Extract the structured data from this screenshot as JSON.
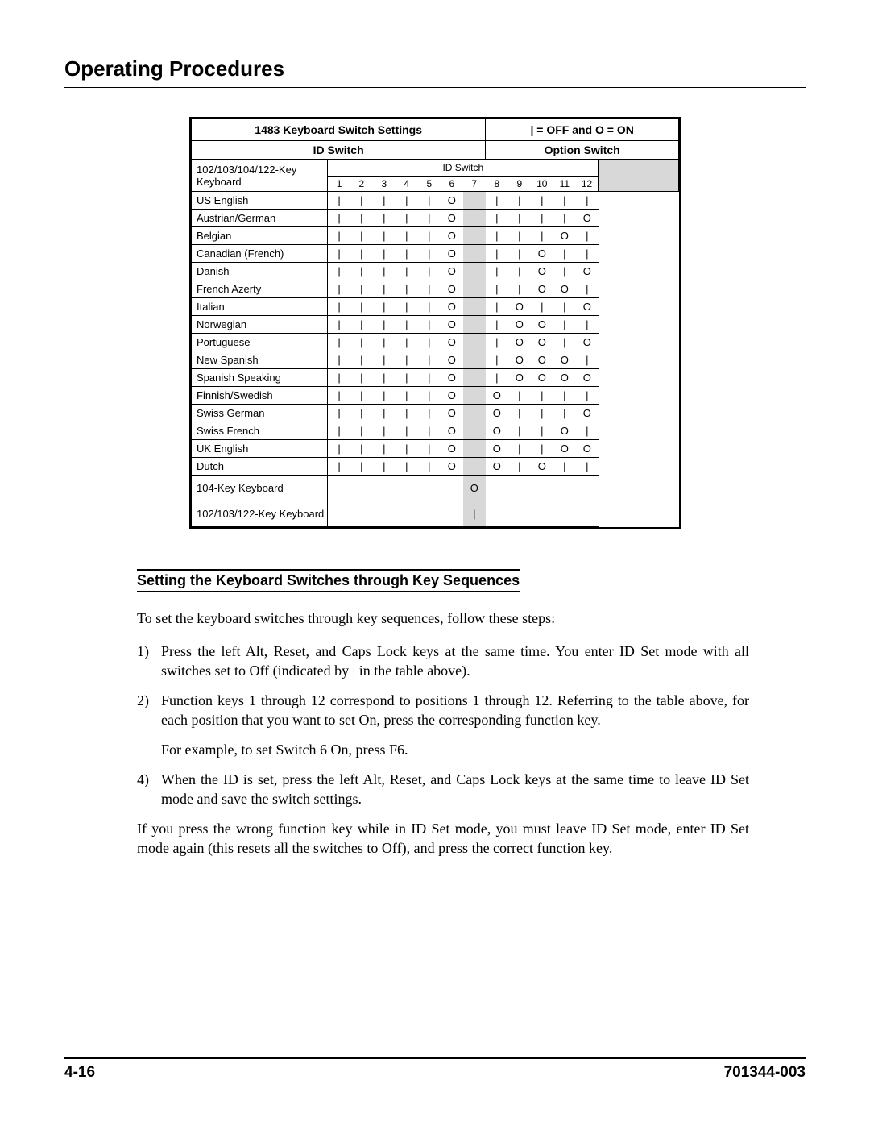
{
  "page_title": "Operating Procedures",
  "table": {
    "title_left": "1483 Keyboard Switch Settings",
    "title_right": "| = OFF and O = ON",
    "id_switch_label": "ID Switch",
    "option_switch_label": "Option Switch",
    "keyboard_type_line1": "102/103/104/122-Key",
    "keyboard_type_line2": "Keyboard",
    "id_switch_sub": "ID Switch",
    "col_nums": [
      "1",
      "2",
      "3",
      "4",
      "5",
      "6",
      "7",
      "8",
      "9",
      "10",
      "11",
      "12"
    ],
    "rows": [
      {
        "label": "US English",
        "sw": [
          "|",
          "|",
          "|",
          "|",
          "|",
          "O",
          "",
          "|",
          "|",
          "|",
          "|",
          "|"
        ]
      },
      {
        "label": "Austrian/German",
        "sw": [
          "|",
          "|",
          "|",
          "|",
          "|",
          "O",
          "",
          "|",
          "|",
          "|",
          "|",
          "O"
        ]
      },
      {
        "label": "Belgian",
        "sw": [
          "|",
          "|",
          "|",
          "|",
          "|",
          "O",
          "",
          "|",
          "|",
          "|",
          "O",
          "|"
        ]
      },
      {
        "label": "Canadian (French)",
        "sw": [
          "|",
          "|",
          "|",
          "|",
          "|",
          "O",
          "",
          "|",
          "|",
          "O",
          "|",
          "|"
        ]
      },
      {
        "label": "Danish",
        "sw": [
          "|",
          "|",
          "|",
          "|",
          "|",
          "O",
          "",
          "|",
          "|",
          "O",
          "|",
          "O"
        ]
      },
      {
        "label": "French Azerty",
        "sw": [
          "|",
          "|",
          "|",
          "|",
          "|",
          "O",
          "",
          "|",
          "|",
          "O",
          "O",
          "|"
        ]
      },
      {
        "label": "Italian",
        "sw": [
          "|",
          "|",
          "|",
          "|",
          "|",
          "O",
          "",
          "|",
          "O",
          "|",
          "|",
          "O"
        ]
      },
      {
        "label": "Norwegian",
        "sw": [
          "|",
          "|",
          "|",
          "|",
          "|",
          "O",
          "",
          "|",
          "O",
          "O",
          "|",
          "|"
        ]
      },
      {
        "label": "Portuguese",
        "sw": [
          "|",
          "|",
          "|",
          "|",
          "|",
          "O",
          "",
          "|",
          "O",
          "O",
          "|",
          "O"
        ]
      },
      {
        "label": "New Spanish",
        "sw": [
          "|",
          "|",
          "|",
          "|",
          "|",
          "O",
          "",
          "|",
          "O",
          "O",
          "O",
          "|"
        ]
      },
      {
        "label": "Spanish Speaking",
        "sw": [
          "|",
          "|",
          "|",
          "|",
          "|",
          "O",
          "",
          "|",
          "O",
          "O",
          "O",
          "O"
        ]
      },
      {
        "label": "Finnish/Swedish",
        "sw": [
          "|",
          "|",
          "|",
          "|",
          "|",
          "O",
          "",
          "O",
          "|",
          "|",
          "|",
          "|"
        ]
      },
      {
        "label": "Swiss German",
        "sw": [
          "|",
          "|",
          "|",
          "|",
          "|",
          "O",
          "",
          "O",
          "|",
          "|",
          "|",
          "O"
        ]
      },
      {
        "label": "Swiss French",
        "sw": [
          "|",
          "|",
          "|",
          "|",
          "|",
          "O",
          "",
          "O",
          "|",
          "|",
          "O",
          "|"
        ]
      },
      {
        "label": "UK English",
        "sw": [
          "|",
          "|",
          "|",
          "|",
          "|",
          "O",
          "",
          "O",
          "|",
          "|",
          "O",
          "O"
        ]
      },
      {
        "label": "Dutch",
        "sw": [
          "|",
          "|",
          "|",
          "|",
          "|",
          "O",
          "",
          "O",
          "|",
          "O",
          "|",
          "|"
        ]
      }
    ],
    "row_104": {
      "label": "104-Key Keyboard",
      "col7": "O"
    },
    "row_102": {
      "label": "102/103/122-Key Keyboard",
      "col7": "|"
    }
  },
  "section_title": "Setting the Keyboard Switches through Key Sequences",
  "intro": "To set the keyboard switches through key sequences, follow these steps:",
  "steps": [
    {
      "num": "1)",
      "text": "Press the left Alt, Reset, and Caps Lock keys at the same time. You enter ID Set mode with all switches set to Off (indicated by | in the table above)."
    },
    {
      "num": "2)",
      "text": "Function keys 1 through 12 correspond to positions 1 through 12. Referring to the table above, for each position that you want to set On, press the corresponding function key."
    }
  ],
  "example": "For example, to set Switch 6 On, press F6.",
  "step4": {
    "num": "4)",
    "text": "When the ID is set, press the left Alt, Reset, and Caps Lock keys at the same time to leave ID Set mode and save the switch settings."
  },
  "closing": "If you press the wrong function key while in ID Set mode, you must leave ID Set mode, enter ID Set mode again (this resets all the switches to Off), and press the correct function key.",
  "footer_left": "4-16",
  "footer_right": "701344-003"
}
